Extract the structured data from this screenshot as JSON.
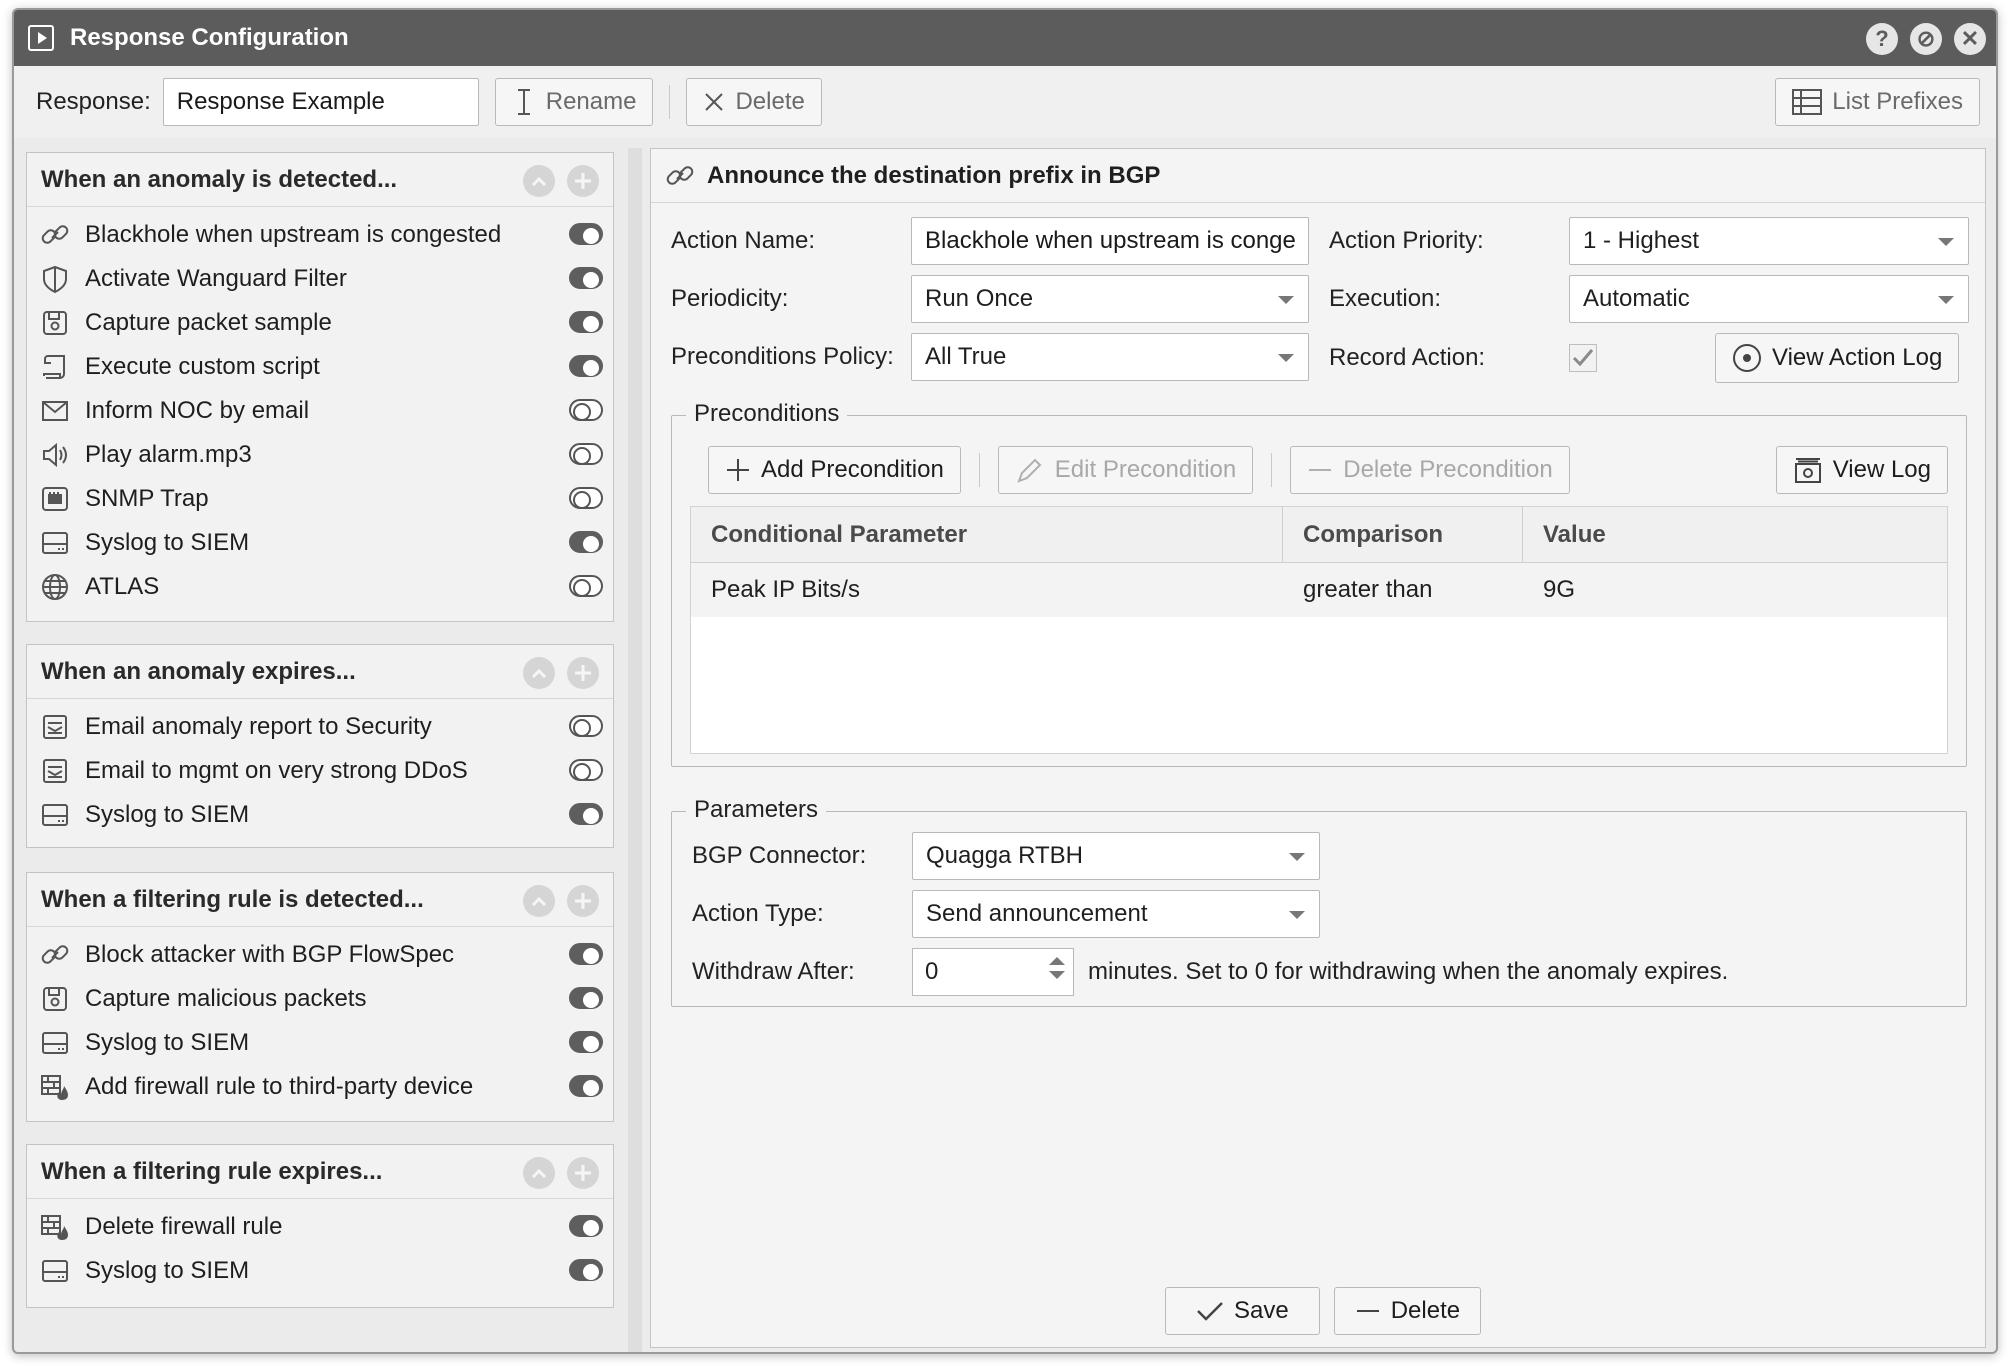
{
  "window": {
    "title": "Response Configuration",
    "help_label": "?",
    "minimize_label": "⊘",
    "close_label": "✕"
  },
  "toolbar": {
    "response_label": "Response:",
    "response_value": "Response Example",
    "rename_label": "Rename",
    "delete_label": "Delete",
    "list_prefixes_label": "List Prefixes"
  },
  "groups": [
    {
      "title": "When an anomaly is detected...",
      "items": [
        {
          "label": "Blackhole when upstream is congested",
          "icon": "link-icon",
          "on": true
        },
        {
          "label": "Activate Wanguard Filter",
          "icon": "shield-icon",
          "on": true
        },
        {
          "label": "Capture packet sample",
          "icon": "save-icon",
          "on": true
        },
        {
          "label": "Execute custom script",
          "icon": "script-icon",
          "on": true
        },
        {
          "label": "Inform NOC by email",
          "icon": "envelope-icon",
          "on": false
        },
        {
          "label": "Play alarm.mp3",
          "icon": "speaker-icon",
          "on": false
        },
        {
          "label": "SNMP Trap",
          "icon": "network-card-icon",
          "on": false
        },
        {
          "label": "Syslog to SIEM",
          "icon": "server-icon",
          "on": true
        },
        {
          "label": "ATLAS",
          "icon": "globe-icon",
          "on": false
        }
      ]
    },
    {
      "title": "When an anomaly expires...",
      "items": [
        {
          "label": "Email anomaly report to Security",
          "icon": "report-icon",
          "on": false
        },
        {
          "label": "Email to mgmt on very strong DDoS",
          "icon": "report-icon",
          "on": false
        },
        {
          "label": "Syslog to SIEM",
          "icon": "server-icon",
          "on": true
        }
      ]
    },
    {
      "title": "When a filtering rule is detected...",
      "items": [
        {
          "label": "Block attacker with BGP FlowSpec",
          "icon": "link-icon",
          "on": true
        },
        {
          "label": "Capture malicious packets",
          "icon": "save-icon",
          "on": true
        },
        {
          "label": "Syslog to SIEM",
          "icon": "server-icon",
          "on": true
        },
        {
          "label": "Add firewall rule to third-party device",
          "icon": "firewall-icon",
          "on": true
        }
      ]
    },
    {
      "title": "When a filtering rule expires...",
      "items": [
        {
          "label": "Delete firewall rule",
          "icon": "firewall-icon",
          "on": true
        },
        {
          "label": "Syslog to SIEM",
          "icon": "server-icon",
          "on": true
        }
      ]
    }
  ],
  "action": {
    "header": "Announce the destination prefix in BGP",
    "name_label": "Action Name:",
    "name_value": "Blackhole when upstream is conge",
    "priority_label": "Action Priority:",
    "priority_value": "1 - Highest",
    "periodicity_label": "Periodicity:",
    "periodicity_value": "Run Once",
    "execution_label": "Execution:",
    "execution_value": "Automatic",
    "policy_label": "Preconditions Policy:",
    "policy_value": "All True",
    "record_label": "Record Action:",
    "record_checked": true,
    "view_action_log_label": "View Action Log"
  },
  "preconditions": {
    "legend": "Preconditions",
    "add_label": "Add Precondition",
    "edit_label": "Edit Precondition",
    "delete_label": "Delete Precondition",
    "view_log_label": "View Log",
    "columns": [
      "Conditional Parameter",
      "Comparison",
      "Value"
    ],
    "rows": [
      {
        "parameter": "Peak IP Bits/s",
        "comparison": "greater than",
        "value": "9G"
      }
    ]
  },
  "parameters": {
    "legend": "Parameters",
    "bgp_label": "BGP Connector:",
    "bgp_value": "Quagga RTBH",
    "type_label": "Action Type:",
    "type_value": "Send announcement",
    "withdraw_label": "Withdraw After:",
    "withdraw_value": "0",
    "withdraw_hint": "minutes. Set to 0 for withdrawing when the anomaly expires."
  },
  "footer": {
    "save_label": "Save",
    "delete_label": "Delete"
  }
}
